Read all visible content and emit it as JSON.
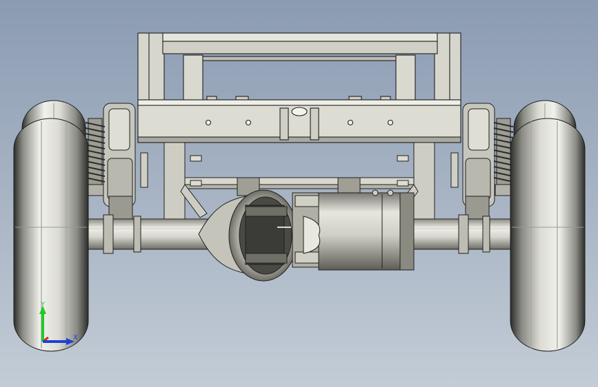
{
  "viewport": {
    "background_top": "#8b9bb2",
    "background_bottom": "#c3ccd6",
    "model_fill_light": "#e9e9e1",
    "model_fill_mid": "#c9c9bf",
    "model_fill_dark": "#7f7f77",
    "model_edge": "#1f1f1f"
  },
  "triad": {
    "x_color": "#1f3fd6",
    "y_color": "#21c928",
    "z_color": "#e02a1e",
    "x_label": "X",
    "y_label": "Y"
  }
}
